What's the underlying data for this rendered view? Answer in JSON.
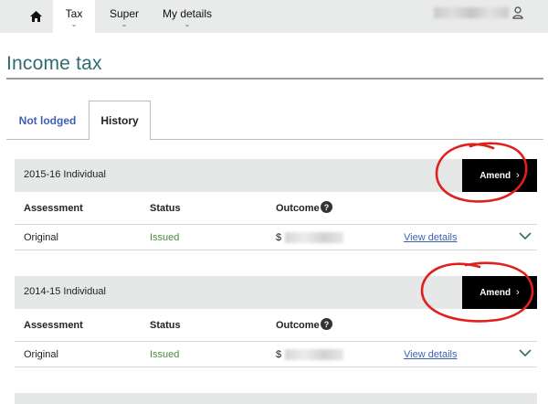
{
  "nav": {
    "home_icon": "home-icon",
    "tabs": [
      {
        "label": "Tax"
      },
      {
        "label": "Super"
      },
      {
        "label": "My details"
      }
    ],
    "user_icon": "user-icon"
  },
  "page": {
    "title": "Income tax"
  },
  "tabs": {
    "not_lodged": "Not lodged",
    "history": "History"
  },
  "columns": {
    "assessment": "Assessment",
    "status": "Status",
    "outcome": "Outcome"
  },
  "records": [
    {
      "title": "2015-16 Individual",
      "amend_label": "Amend",
      "assessment": "Original",
      "status": "Issued",
      "outcome_prefix": "$",
      "view_label": "View details"
    },
    {
      "title": "2014-15 Individual",
      "amend_label": "Amend",
      "assessment": "Original",
      "status": "Issued",
      "outcome_prefix": "$",
      "view_label": "View details"
    }
  ],
  "colors": {
    "title": "#2f6c6f",
    "link": "#3d5fb8",
    "status_issued": "#4b8a3d",
    "amend_button": "#000000",
    "annotation": "#e0201c"
  }
}
